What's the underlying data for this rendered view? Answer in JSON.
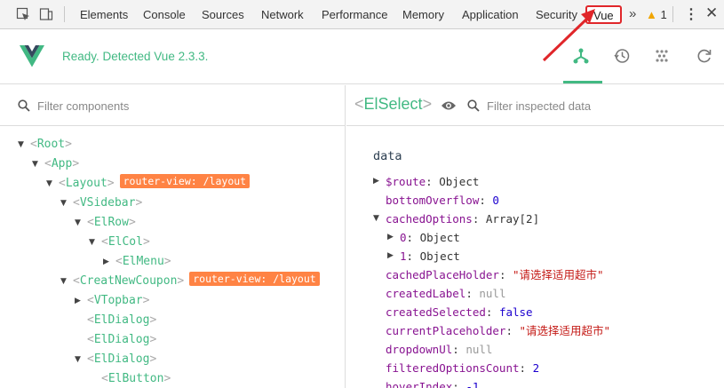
{
  "tabbar": {
    "tabs": [
      {
        "label": "Elements"
      },
      {
        "label": "Console"
      },
      {
        "label": "Sources"
      },
      {
        "label": "Network"
      },
      {
        "label": "Performance"
      },
      {
        "label": "Memory"
      },
      {
        "label": "Application"
      },
      {
        "label": "Security"
      },
      {
        "label": "Vue"
      }
    ],
    "active_tab": "Vue",
    "more": "»",
    "warning_count": "1",
    "accent_color": "#e0262a"
  },
  "header": {
    "status": "Ready. Detected Vue 2.3.3.",
    "brand_color": "#42b983",
    "icons": [
      "components-icon",
      "history-icon",
      "vuex-icon",
      "refresh-icon"
    ]
  },
  "left": {
    "filter_placeholder": "Filter components",
    "tree": [
      {
        "name": "Root",
        "toggle": "▼",
        "badge": ""
      },
      {
        "name": "App",
        "toggle": "▼",
        "badge": ""
      },
      {
        "name": "Layout",
        "toggle": "▼",
        "badge": "router-view: /layout"
      },
      {
        "name": "VSidebar",
        "toggle": "▼",
        "badge": ""
      },
      {
        "name": "ElRow",
        "toggle": "▼",
        "badge": ""
      },
      {
        "name": "ElCol",
        "toggle": "▼",
        "badge": ""
      },
      {
        "name": "ElMenu",
        "toggle": "▶",
        "badge": ""
      },
      {
        "name": "CreatNewCoupon",
        "toggle": "▼",
        "badge": "router-view: /layout"
      },
      {
        "name": "VTopbar",
        "toggle": "▶",
        "badge": ""
      },
      {
        "name": "ElDialog",
        "toggle": "",
        "badge": ""
      },
      {
        "name": "ElDialog",
        "toggle": "",
        "badge": ""
      },
      {
        "name": "ElDialog",
        "toggle": "▼",
        "badge": ""
      },
      {
        "name": "ElButton",
        "toggle": "",
        "badge": ""
      }
    ]
  },
  "right": {
    "selected_component": "ElSelect",
    "filter_placeholder": "Filter inspected data",
    "section_title": "data",
    "props": [
      {
        "toggle": "▶",
        "key": "$route",
        "value": "Object",
        "type": "plain"
      },
      {
        "toggle": "",
        "key": "bottomOverflow",
        "value": "0",
        "type": "num"
      },
      {
        "toggle": "▼",
        "key": "cachedOptions",
        "value": "Array[2]",
        "type": "plain"
      },
      {
        "toggle": "▶",
        "key": "0",
        "value": "Object",
        "type": "plain"
      },
      {
        "toggle": "▶",
        "key": "1",
        "value": "Object",
        "type": "plain"
      },
      {
        "toggle": "",
        "key": "cachedPlaceHolder",
        "value": "\"请选择适用超市\"",
        "type": "str"
      },
      {
        "toggle": "",
        "key": "createdLabel",
        "value": "null",
        "type": "null"
      },
      {
        "toggle": "",
        "key": "createdSelected",
        "value": "false",
        "type": "num"
      },
      {
        "toggle": "",
        "key": "currentPlaceholder",
        "value": "\"请选择适用超市\"",
        "type": "str"
      },
      {
        "toggle": "",
        "key": "dropdownUl",
        "value": "null",
        "type": "null"
      },
      {
        "toggle": "",
        "key": "filteredOptionsCount",
        "value": "2",
        "type": "num"
      },
      {
        "toggle": "",
        "key": "hoverIndex",
        "value": "-1",
        "type": "num"
      }
    ]
  }
}
